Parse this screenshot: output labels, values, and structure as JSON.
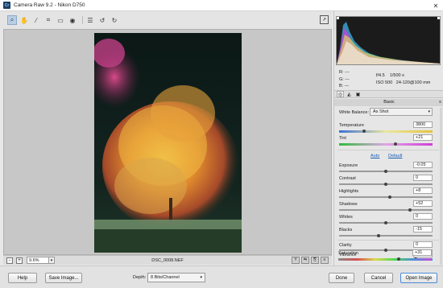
{
  "window": {
    "title": "Camera Raw 9.2  -  Nikon D750"
  },
  "toolbar": {
    "tools": [
      "zoom-icon",
      "hand-icon",
      "white-balance-icon",
      "crop-icon",
      "straighten-icon",
      "redeye-icon",
      "preferences-icon",
      "rotate-left-icon",
      "rotate-right-icon"
    ]
  },
  "status": {
    "zoom_value": "9.6%",
    "zoom_minus": "-",
    "zoom_plus": "+",
    "filename": "DSC_0008.NEF"
  },
  "readout": {
    "r_label": "R:",
    "r_value": "---",
    "g_label": "G:",
    "g_value": "---",
    "b_label": "B:",
    "b_value": "---",
    "aperture": "f/4.5",
    "shutter": "1/500 s",
    "iso": "ISO 500",
    "lens": "24-120@100 mm"
  },
  "panel": {
    "title": "Basic",
    "white_balance_label": "White Balance:",
    "white_balance_value": "As Shot",
    "auto_label": "Auto",
    "default_label": "Default"
  },
  "sliders": {
    "temperature": {
      "label": "Temperature",
      "value": "3800",
      "level": 0.27
    },
    "tint": {
      "label": "Tint",
      "value": "+21",
      "level": 0.6
    },
    "exposure": {
      "label": "Exposure",
      "value": "-0.05",
      "level": 0.5
    },
    "contrast": {
      "label": "Contrast",
      "value": "0",
      "level": 0.5
    },
    "highlights": {
      "label": "Highlights",
      "value": "+8",
      "level": 0.54
    },
    "shadows": {
      "label": "Shadows",
      "value": "+52",
      "level": 0.76
    },
    "whites": {
      "label": "Whites",
      "value": "0",
      "level": 0.5
    },
    "blacks": {
      "label": "Blacks",
      "value": "-15",
      "level": 0.42
    },
    "clarity": {
      "label": "Clarity",
      "value": "0",
      "level": 0.5
    },
    "vibrance": {
      "label": "Vibrance",
      "value": "+64",
      "level": 0.82
    },
    "saturation": {
      "label": "Saturation",
      "value": "+31",
      "level": 0.65
    }
  },
  "bottom": {
    "help": "Help",
    "save": "Save Image...",
    "depth_label": "Depth:",
    "depth_value": "8 Bits/Channel",
    "done": "Done",
    "cancel": "Cancel",
    "open": "Open Image"
  }
}
